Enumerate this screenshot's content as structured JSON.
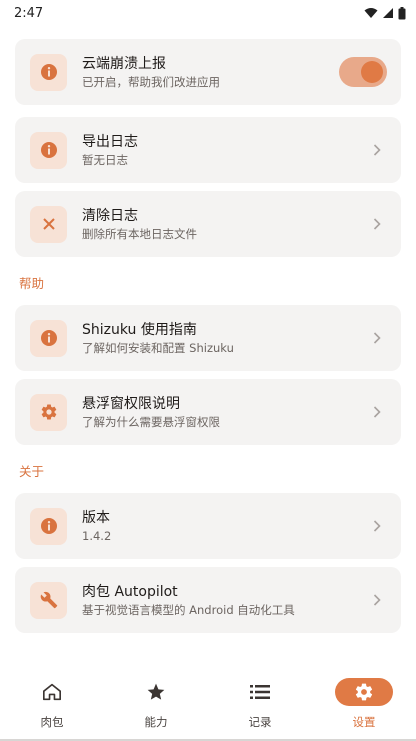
{
  "status_bar": {
    "time": "2:47"
  },
  "cards": [
    {
      "title": "云端崩溃上报",
      "subtitle": "已开启，帮助我们改进应用",
      "icon": "info-icon",
      "control": "toggle",
      "toggle_on": true
    },
    {
      "title": "导出日志",
      "subtitle": "暂无日志",
      "icon": "info-icon",
      "control": "chevron"
    },
    {
      "title": "清除日志",
      "subtitle": "删除所有本地日志文件",
      "icon": "close-icon",
      "control": "chevron"
    },
    {
      "title": "Shizuku 使用指南",
      "subtitle": "了解如何安装和配置 Shizuku",
      "icon": "info-icon",
      "control": "chevron"
    },
    {
      "title": "悬浮窗权限说明",
      "subtitle": "了解为什么需要悬浮窗权限",
      "icon": "gear-icon",
      "control": "chevron"
    },
    {
      "title": "版本",
      "subtitle": "1.4.2",
      "icon": "info-icon",
      "control": "chevron"
    },
    {
      "title": "肉包 Autopilot",
      "subtitle": "基于视觉语言模型的 Android 自动化工具",
      "icon": "wrench-icon",
      "control": "chevron"
    }
  ],
  "sections": {
    "help": "帮助",
    "about": "关于"
  },
  "nav": [
    {
      "label": "肉包",
      "icon": "home-icon",
      "active": false
    },
    {
      "label": "能力",
      "icon": "star-icon",
      "active": false
    },
    {
      "label": "记录",
      "icon": "list-icon",
      "active": false
    },
    {
      "label": "设置",
      "icon": "gear-icon",
      "active": true
    }
  ],
  "colors": {
    "accent": "#e07a45",
    "icon_bg": "#f7e2d6",
    "card_bg": "#f4f3f2"
  }
}
